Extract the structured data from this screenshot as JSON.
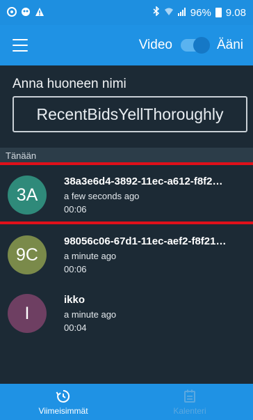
{
  "status_bar": {
    "battery": "96%",
    "time": "9.08"
  },
  "app_bar": {
    "video_label": "Video",
    "audio_label": "Ääni",
    "video_audio_toggle_on": true
  },
  "room": {
    "label": "Anna huoneen nimi",
    "value": "RecentBidsYellThoroughly"
  },
  "section": {
    "title": "Tänään"
  },
  "items": [
    {
      "initials": "3A",
      "title": "38a3e6d4-3892-11ec-a612-f8f2…",
      "time": "a few seconds ago",
      "duration": "00:06",
      "color": "#2f8a7a"
    },
    {
      "initials": "9C",
      "title": "98056c06-67d1-11ec-aef2-f8f21…",
      "time": "a minute ago",
      "duration": "00:06",
      "color": "#7a8a4a"
    },
    {
      "initials": "I",
      "title": "ikko",
      "time": "a minute ago",
      "duration": "00:04",
      "color": "#6e3f62"
    }
  ],
  "bottom_nav": {
    "recent_label": "Viimeisimmät",
    "calendar_label": "Kalenteri",
    "recent_icon": "history-icon",
    "calendar_icon": "calendar-icon"
  },
  "colors": {
    "primary": "#1f92e4",
    "background": "#1c2a35",
    "highlight_line": "#e0101a"
  }
}
